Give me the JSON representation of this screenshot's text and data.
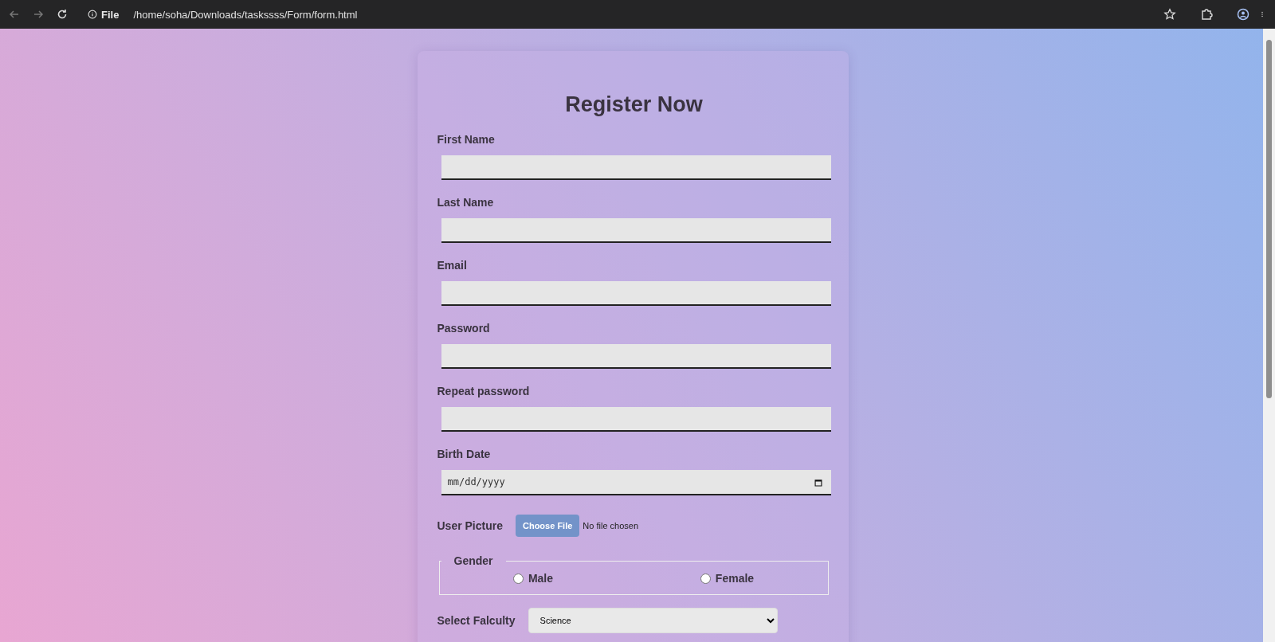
{
  "browser": {
    "site_chip": "File",
    "url": "/home/soha/Downloads/taskssss/Form/form.html"
  },
  "form": {
    "title": "Register Now",
    "fields": [
      {
        "label": "First Name",
        "kind": "text"
      },
      {
        "label": "Last Name",
        "kind": "text"
      },
      {
        "label": "Email",
        "kind": "text"
      },
      {
        "label": "Password",
        "kind": "text"
      },
      {
        "label": "Repeat password",
        "kind": "text"
      },
      {
        "label": "Birth Date",
        "kind": "date",
        "placeholder": "mm/dd/yyyy"
      }
    ],
    "picture": {
      "label": "User Picture",
      "button": "Choose File",
      "status": "No file chosen"
    },
    "gender": {
      "legend": "Gender",
      "options": [
        {
          "label": "Male",
          "selected": false
        },
        {
          "label": "Female",
          "selected": false
        }
      ]
    },
    "faculty": {
      "label": "Select Falculty",
      "value": "Science"
    }
  }
}
